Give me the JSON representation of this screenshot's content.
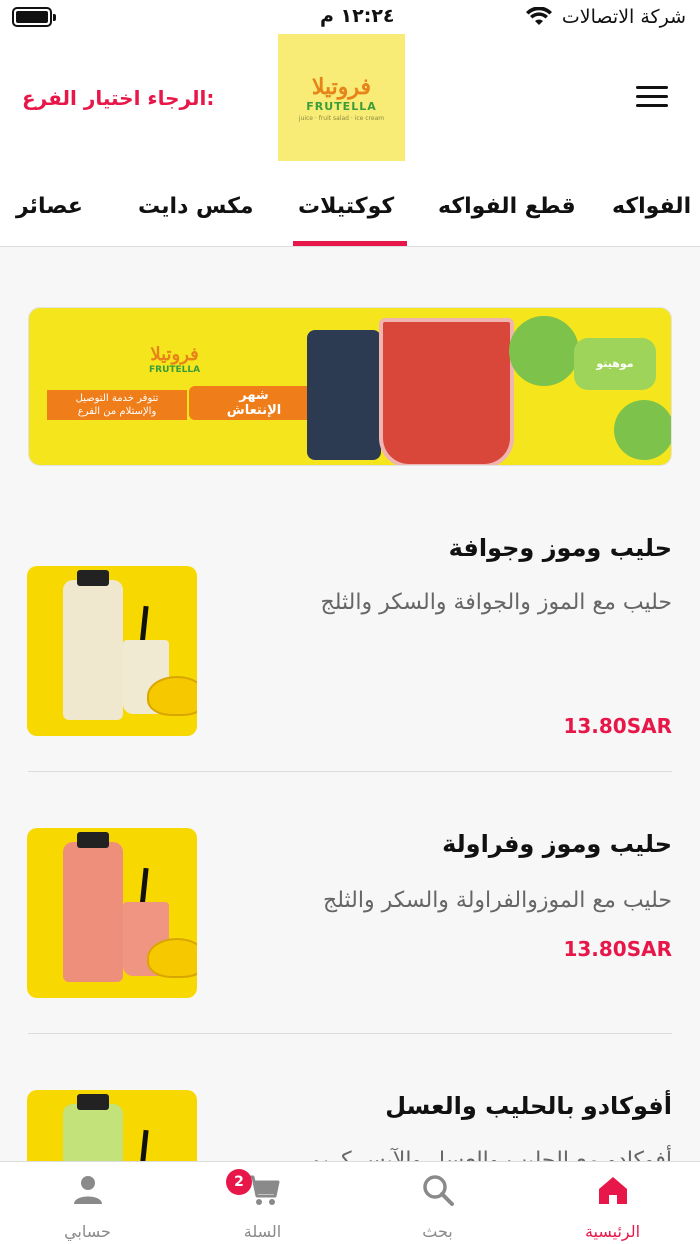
{
  "status_bar": {
    "carrier": "شركة الاتصالات",
    "time": "١٢:٢٤ م"
  },
  "header": {
    "branch_prompt": "الرجاء اختيار الفرع:",
    "logo_ar": "فروتيلا",
    "logo_en": "FRUTELLA",
    "logo_tagline": "juice · fruit salad · ice cream"
  },
  "tabs": [
    {
      "label": "الفواكه"
    },
    {
      "label": "قطع الفواكه"
    },
    {
      "label": "كوكتيلات"
    },
    {
      "label": "مكس دايت"
    },
    {
      "label": "عصائر"
    }
  ],
  "active_tab_index": 2,
  "banner": {
    "logo_ar": "فروتيلا",
    "logo_en": "FRUTELLA",
    "badge_line1": "شهر",
    "badge_line2": "الإنتعاش",
    "delivery_line1": "تتوفر خدمة التوصيل",
    "delivery_line2": "والإستلام من الفرع",
    "tag": "موهيتو"
  },
  "products": [
    {
      "name": "حليب وموز وجوافة",
      "description": "حليب مع الموز والجوافة والسكر والثلج",
      "price": "13.80SAR",
      "bottle_color": "#efe8cf",
      "glass_color": "#f1ead3"
    },
    {
      "name": "حليب وموز وفراولة",
      "description": "حليب مع الموزوالفراولة والسكر والثلج",
      "price": "13.80SAR",
      "bottle_color": "#ee8f7c",
      "glass_color": "#ef9582"
    },
    {
      "name": "أفوكادو بالحليب والعسل",
      "description": "أفوكادو مع الحليب والعسل والآيس كريم",
      "price": "",
      "bottle_color": "#c4e27a",
      "glass_color": "#c4e27a"
    }
  ],
  "bottom_nav": {
    "items": [
      {
        "label": "الرئيسية",
        "icon": "home-icon"
      },
      {
        "label": "بحث",
        "icon": "search-icon"
      },
      {
        "label": "السلة",
        "icon": "cart-icon"
      },
      {
        "label": "حسابي",
        "icon": "person-icon"
      }
    ],
    "cart_count": "2"
  },
  "colors": {
    "accent": "#e8174a",
    "logo_bg": "#f8ec76",
    "banner_bg": "#f4e51d",
    "product_bg": "#f7d800"
  }
}
